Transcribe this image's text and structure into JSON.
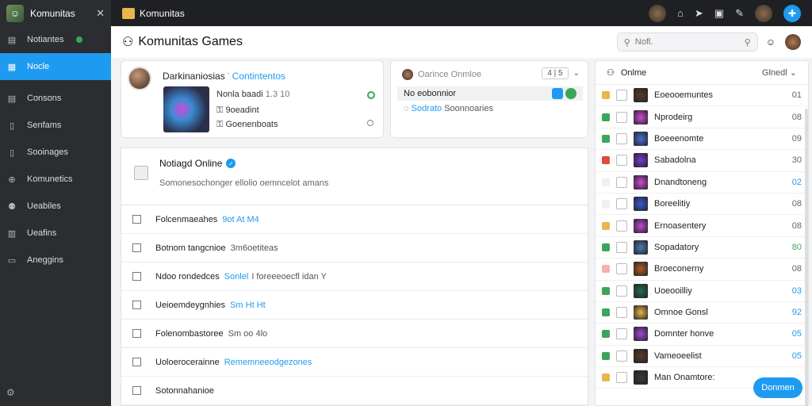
{
  "sidebar": {
    "title": "Komunitas",
    "items": [
      {
        "label": "Notiantes",
        "icon": "notes-icon"
      },
      {
        "label": "Nocle",
        "icon": "grid-icon"
      },
      {
        "label": "Consons",
        "icon": "list-icon"
      },
      {
        "label": "Senfams",
        "icon": "doc-icon"
      },
      {
        "label": "Sooinages",
        "icon": "doc-icon"
      },
      {
        "label": "Komunetics",
        "icon": "globe-icon"
      },
      {
        "label": "Ueabiles",
        "icon": "user-icon"
      },
      {
        "label": "Ueafins",
        "icon": "chart-icon"
      },
      {
        "label": "Aneggins",
        "icon": "file-icon"
      }
    ]
  },
  "topbar": {
    "title": "Komunitas"
  },
  "header": {
    "title": "Komunitas Games",
    "search_text": "Nofl."
  },
  "profile": {
    "name": "Darkinaniosias",
    "link": "Contintentos",
    "line1": "Nonla baadi",
    "line1_meta": "1.3 10",
    "line2": "9oeadint",
    "line3": "Goenenboats"
  },
  "status": {
    "label": "Oarince Onmloe",
    "ctrl1": "4",
    "ctrl2": "5",
    "row": "No eobonnior",
    "sub_blue": "Sodrato",
    "sub_gray": "Soonnoaries"
  },
  "online": {
    "title": "Notiagd Online",
    "desc": "Somonesochonger ellolio oemncelot amans"
  },
  "list_rows": [
    {
      "name": "Folcenmaeahes",
      "meta": "9ot At M4",
      "meta_style": "blue"
    },
    {
      "name": "Botnom tangcnioe",
      "meta": "3m6oetiteas",
      "meta_style": "gray"
    },
    {
      "name": "Ndoo rondedces",
      "meta": "Sonlel",
      "meta2": "I foreeeoecfl idan Y",
      "meta_style": "blue"
    },
    {
      "name": "Ueioemdeygnhies",
      "meta": "Sm Ht Ht",
      "meta_style": "blue"
    },
    {
      "name": "Folenombastoree",
      "meta": "Sm oo 4lo",
      "meta_style": "gray"
    },
    {
      "name": "Uoloerocerainne",
      "meta": "Rememneeodgezones",
      "meta_style": "blue"
    },
    {
      "name": "Sotonnahanioe",
      "meta": "",
      "meta_style": "gray"
    }
  ],
  "right_panel": {
    "title": "Onlme",
    "selector": "Glnedl",
    "rows": [
      {
        "name": "Eoeooemuntes",
        "count": "01",
        "sq": "#e8b64c",
        "thumb": "#5a3a2a",
        "style": "gray"
      },
      {
        "name": "Nprodeirg",
        "count": "08",
        "sq": "#3ba55c",
        "thumb": "#d14ad9",
        "style": "gray"
      },
      {
        "name": "Boeeenomte",
        "count": "09",
        "sq": "#3ba55c",
        "thumb": "#4a6fd4",
        "style": "gray"
      },
      {
        "name": "Sabadolna",
        "count": "30",
        "sq": "#e04b3a",
        "thumb": "#7a3ad4",
        "style": "gray"
      },
      {
        "name": "Dnandtoneng",
        "count": "02",
        "sq": "#f0f0f0",
        "thumb": "#d14ad9",
        "style": "blue"
      },
      {
        "name": "Boreelitiy",
        "count": "08",
        "sq": "#f0f0f0",
        "thumb": "#3a5ad4",
        "style": "gray"
      },
      {
        "name": "Ernoasentery",
        "count": "08",
        "sq": "#e8b64c",
        "thumb": "#c04ad4",
        "style": "gray"
      },
      {
        "name": "Sopadatory",
        "count": "80",
        "sq": "#3ba55c",
        "thumb": "#4a7ab4",
        "style": "green"
      },
      {
        "name": "Broeconerny",
        "count": "08",
        "sq": "#f4b2aa",
        "thumb": "#b45a2a",
        "style": "gray"
      },
      {
        "name": "Uoeooilliy",
        "count": "03",
        "sq": "#3ba55c",
        "thumb": "#2a6a4a",
        "style": "blue"
      },
      {
        "name": "Omnoe Gonsl",
        "count": "92",
        "sq": "#3ba55c",
        "thumb": "#e8b64c",
        "style": "blue"
      },
      {
        "name": "Domnter honve",
        "count": "05",
        "sq": "#3ba55c",
        "thumb": "#a04ad9",
        "style": "blue"
      },
      {
        "name": "Vameoeelist",
        "count": "05",
        "sq": "#3ba55c",
        "thumb": "#5a3a2a",
        "style": "blue"
      },
      {
        "name": "Man Onamtore:",
        "count": "",
        "sq": "#e8b64c",
        "thumb": "#3a3a3a",
        "style": "gray"
      }
    ]
  },
  "fab_label": "Donmen"
}
